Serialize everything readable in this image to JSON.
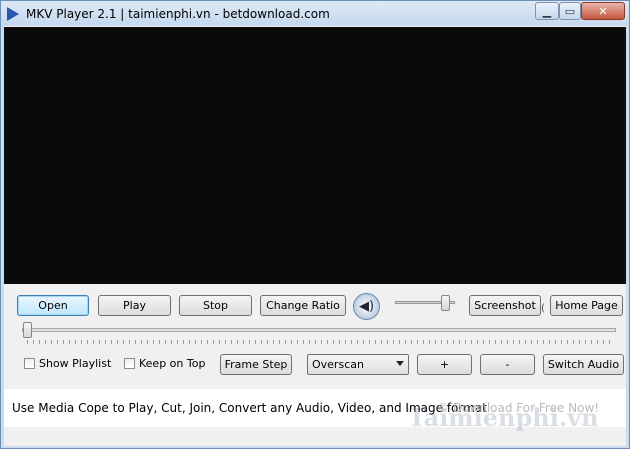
{
  "window": {
    "title": "MKV Player 2.1 | taimienphi.vn - betdownload.com",
    "controls": {
      "minimize": "▁",
      "maximize": "▭",
      "close": "✕"
    }
  },
  "toolbar": {
    "open": "Open",
    "play": "Play",
    "stop": "Stop",
    "change_ratio": "Change Ratio",
    "volume_icon": "speaker-icon",
    "screenshot": "Screenshot",
    "home_page": "Home Page"
  },
  "volume": {
    "level": 0.85
  },
  "seek": {
    "position": 0.0
  },
  "options": {
    "show_playlist": "Show Playlist",
    "keep_on_top": "Keep on Top",
    "frame_step": "Frame Step",
    "mode_selected": "Overscan",
    "plus": "+",
    "minus": "-",
    "switch_audio": "Switch Audio"
  },
  "status": {
    "text": "Use Media Cope to Play, Cut, Join, Convert any Audio, Video, and Image format",
    "link": "© Download For Free Now!",
    "watermark": "Taimienphi.vn"
  }
}
